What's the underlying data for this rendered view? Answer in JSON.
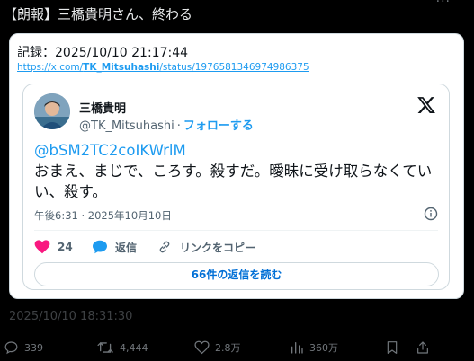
{
  "post": {
    "title": "【朗報】三橋貴明さん、終わる",
    "menu_glyph": "···"
  },
  "card": {
    "record_label": "記録：2025/10/10 21:17:44",
    "link_prefix": "https://x.com/",
    "link_user": "TK_Mitsuhashi",
    "link_suffix": "/status/1976581346974986375"
  },
  "tweet": {
    "display_name": "三橋貴明",
    "handle": "@TK_Mitsuhashi",
    "separator": "·",
    "follow_label": "フォローする",
    "mention": "@bSM2TC2coIKWrlM",
    "text": "おまえ、まじで、ころす。殺すだ。曖昧に受け取らなくていい、殺す。",
    "timestamp": "午後6:31 · 2025年10月10日",
    "like_count": "24",
    "reply_label": "返信",
    "copy_link_label": "リンクをコピー",
    "read_replies_label": "66件の返信を読む",
    "colors": {
      "accent": "#1d9bf0",
      "like": "#f91880",
      "text": "#0f1419",
      "muted": "#536471"
    }
  },
  "footer": {
    "timestamp": "2025/10/10 18:31:30"
  },
  "engagement": {
    "replies": "339",
    "reposts": "4,444",
    "likes": "2.8万",
    "views": "360万"
  },
  "icons": [
    "x-logo-icon",
    "info-icon",
    "heart-icon",
    "speech-bubble-icon",
    "link-icon",
    "reply-icon",
    "repost-icon",
    "like-icon",
    "views-icon",
    "bookmark-icon",
    "share-icon"
  ]
}
